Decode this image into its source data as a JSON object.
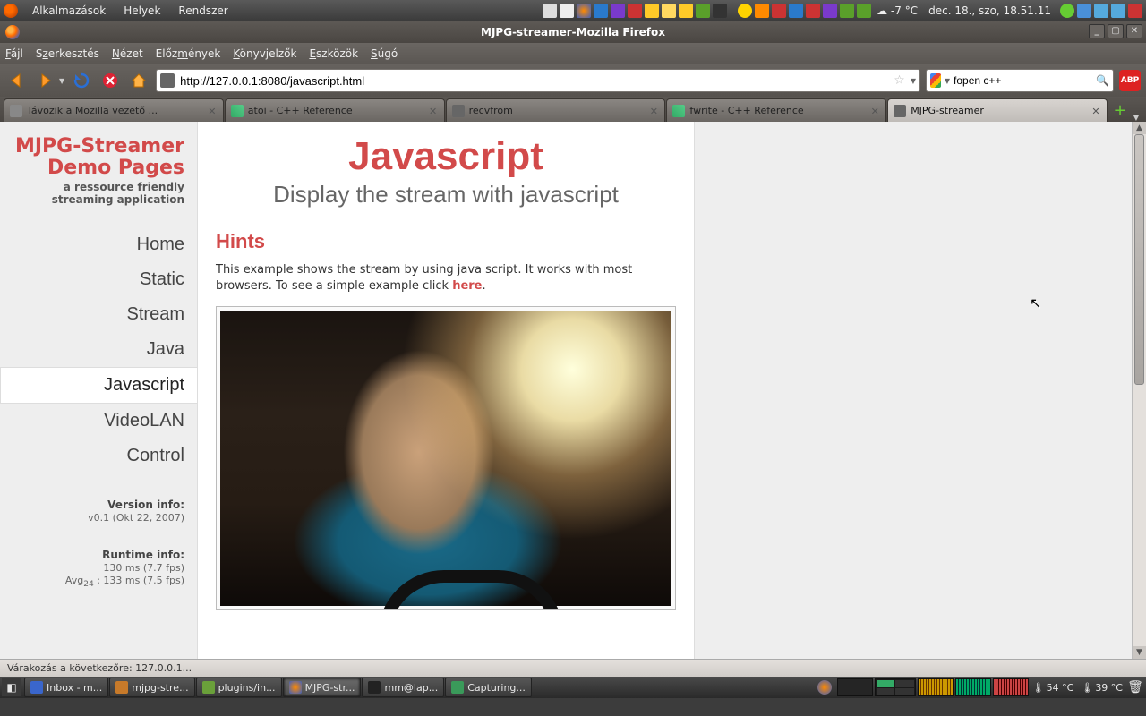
{
  "top_panel": {
    "menus": [
      "Alkalmazások",
      "Helyek",
      "Rendszer"
    ],
    "weather": "-7 °C",
    "clock": "dec. 18., szo, 18.51.11"
  },
  "window": {
    "title": "MJPG-streamer-Mozilla Firefox"
  },
  "ff_menus": [
    {
      "t": "Fájl",
      "u": 0
    },
    {
      "t": "Szerkesztés",
      "u": 0
    },
    {
      "t": "Nézet",
      "u": 0
    },
    {
      "t": "Előzmények",
      "u": 3
    },
    {
      "t": "Könyvjelzők",
      "u": 0
    },
    {
      "t": "Eszközök",
      "u": 0
    },
    {
      "t": "Súgó",
      "u": 0
    }
  ],
  "url": "http://127.0.0.1:8080/javascript.html",
  "search_value": "fopen c++",
  "abp": "ABP",
  "tabs": [
    {
      "label": "Távozik a Mozilla vezető ..."
    },
    {
      "label": "atoi - C++ Reference"
    },
    {
      "label": "recvfrom"
    },
    {
      "label": "fwrite - C++ Reference"
    },
    {
      "label": "MJPG-streamer",
      "active": true
    }
  ],
  "sidebar": {
    "title1": "MJPG-Streamer",
    "title2": "Demo Pages",
    "tag1": "a ressource friendly",
    "tag2": "streaming application",
    "nav": [
      "Home",
      "Static",
      "Stream",
      "Java",
      "Javascript",
      "VideoLAN",
      "Control"
    ],
    "nav_sel": 4,
    "vinfo_hdr": "Version info:",
    "vinfo": "v0.1 (Okt 22, 2007)",
    "rinfo_hdr": "Runtime info:",
    "rinfo1": "130 ms (7.7 fps)",
    "rinfo2_pre": "Avg",
    "rinfo2_sub": "24",
    "rinfo2_post": " : 133 ms (7.5 fps)"
  },
  "main": {
    "h1": "Javascript",
    "subtitle": "Display the stream with javascript",
    "h2": "Hints",
    "p1a": "This example shows the stream by using java script. It works with most browsers. To see a simple example click ",
    "p1_link": "here",
    "p1b": "."
  },
  "status": "Várakozás a következőre: 127.0.0.1...",
  "tasks": [
    {
      "label": "Inbox - m...",
      "c": "#3a66cc"
    },
    {
      "label": "mjpg-stre...",
      "c": "#c77a2a"
    },
    {
      "label": "plugins/in...",
      "c": "#6aa03a"
    },
    {
      "label": "MJPG-str...",
      "c": "#ff6a00",
      "active": true
    },
    {
      "label": "mm@lap...",
      "c": "#222"
    },
    {
      "label": "Capturing...",
      "c": "#3a9a5a"
    }
  ],
  "temps": {
    "t1": "54 °C",
    "t2": "39 °C"
  }
}
